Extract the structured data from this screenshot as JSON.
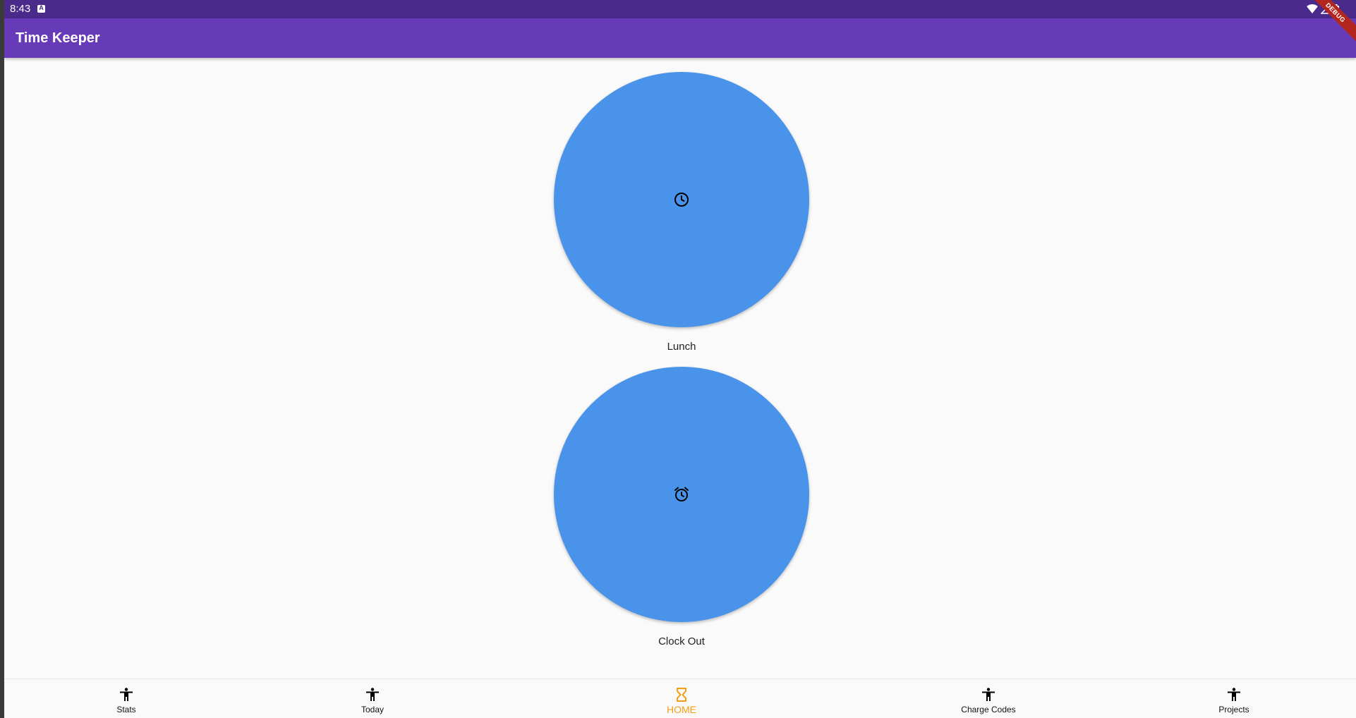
{
  "status_bar": {
    "time": "8:43",
    "notification_icon": "a-icon",
    "right_icons": [
      "wifi-icon",
      "signal-icon",
      "battery-icon"
    ]
  },
  "app_bar": {
    "title": "Time Keeper",
    "background": "#673ab7"
  },
  "debug_banner": {
    "label": "DEBUG"
  },
  "actions": [
    {
      "label": "Lunch",
      "icon": "clock-icon",
      "color": "#4a93ea"
    },
    {
      "label": "Clock Out",
      "icon": "alarm-icon",
      "color": "#4a93ea"
    }
  ],
  "bottom_nav": {
    "active_color": "#f39c12",
    "items": [
      {
        "label": "Stats",
        "icon": "accessibility-icon",
        "active": false
      },
      {
        "label": "Today",
        "icon": "accessibility-icon",
        "active": false
      },
      {
        "label": "HOME",
        "icon": "hourglass-icon",
        "active": true
      },
      {
        "label": "Charge Codes",
        "icon": "accessibility-icon",
        "active": false
      },
      {
        "label": "Projects",
        "icon": "accessibility-icon",
        "active": false
      }
    ]
  }
}
